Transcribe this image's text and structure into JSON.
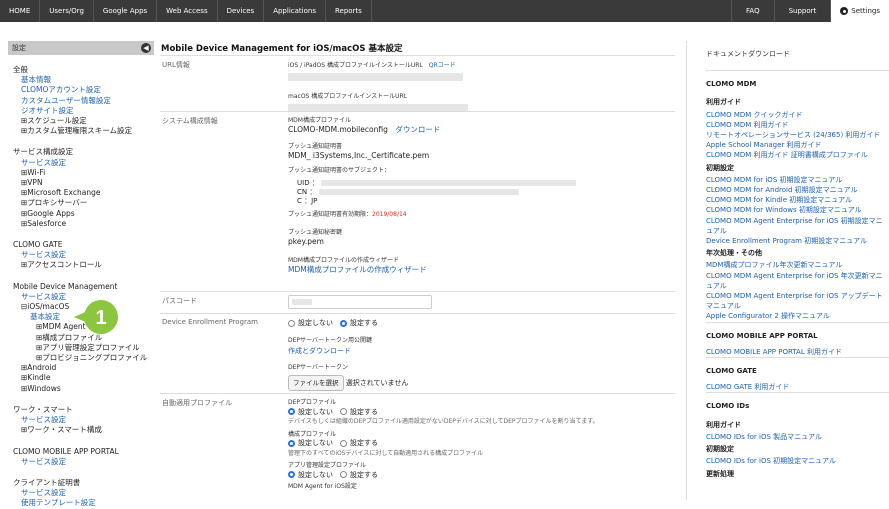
{
  "topnav": {
    "left": [
      "HOME",
      "Users/Org",
      "Google Apps",
      "Web Access",
      "Devices",
      "Applications",
      "Reports"
    ],
    "faq": "FAQ",
    "support": "Support",
    "settings": "Settings"
  },
  "sidebar": {
    "header": "設定",
    "items": [
      {
        "t": "grp",
        "label": "全般"
      },
      {
        "t": "lnk",
        "label": "基本情報"
      },
      {
        "t": "lnk",
        "label": "CLOMOアカウント設定"
      },
      {
        "t": "lnk",
        "label": "カスタムユーザー情報設定"
      },
      {
        "t": "lnk",
        "label": "ジオサイト設定"
      },
      {
        "t": "sub",
        "label": "⊞スケジュール設定"
      },
      {
        "t": "sub",
        "label": "⊞カスタム管理権限スキーム設定"
      },
      {
        "t": "gap"
      },
      {
        "t": "grp",
        "label": "サービス構成設定"
      },
      {
        "t": "lnk",
        "label": "サービス設定"
      },
      {
        "t": "sub",
        "label": "⊞Wi-Fi"
      },
      {
        "t": "sub",
        "label": "⊞VPN"
      },
      {
        "t": "sub",
        "label": "⊞Microsoft Exchange"
      },
      {
        "t": "sub",
        "label": "⊞プロキシサーバー"
      },
      {
        "t": "sub",
        "label": "⊞Google Apps"
      },
      {
        "t": "sub",
        "label": "⊞Salesforce"
      },
      {
        "t": "gap"
      },
      {
        "t": "grp",
        "label": "CLOMO GATE"
      },
      {
        "t": "lnk",
        "label": "サービス設定"
      },
      {
        "t": "sub",
        "label": "⊞アクセスコントロール"
      },
      {
        "t": "gap"
      },
      {
        "t": "grp",
        "label": "Mobile Device Management"
      },
      {
        "t": "lnk",
        "label": "サービス設定"
      },
      {
        "t": "sub",
        "label": "⊟iOS/macOS"
      },
      {
        "t": "sub2a",
        "label": "基本設定"
      },
      {
        "t": "sub3",
        "label": "⊞MDM Agent"
      },
      {
        "t": "sub3",
        "label": "⊞構成プロファイル"
      },
      {
        "t": "sub3",
        "label": "⊞アプリ管理設定プロファイル"
      },
      {
        "t": "sub3",
        "label": "⊞プロビジョニングプロファイル"
      },
      {
        "t": "sub",
        "label": "⊞Android"
      },
      {
        "t": "sub",
        "label": "⊞Kindle"
      },
      {
        "t": "sub",
        "label": "⊞Windows"
      },
      {
        "t": "gap"
      },
      {
        "t": "grp",
        "label": "ワーク・スマート"
      },
      {
        "t": "lnk",
        "label": "サービス設定"
      },
      {
        "t": "sub",
        "label": "⊞ワーク・スマート構成"
      },
      {
        "t": "gap"
      },
      {
        "t": "grp",
        "label": "CLOMO MOBILE APP PORTAL"
      },
      {
        "t": "lnk",
        "label": "サービス設定"
      },
      {
        "t": "gap"
      },
      {
        "t": "grp",
        "label": "クライアント証明書"
      },
      {
        "t": "lnk",
        "label": "サービス設定"
      },
      {
        "t": "lnk",
        "label": "使用テンプレート設定"
      }
    ]
  },
  "callout": "1",
  "main": {
    "title": "Mobile Device Management for iOS/macOS 基本設定",
    "url_label": "URL情報",
    "url_ios": "iOS / iPadOS 構成プロファイルインストールURL",
    "qr": "QRコード",
    "url_mac": "macOS 構成プロファイルインストールURL",
    "sys_label": "システム構成情報",
    "mdm_profile": "MDM構成プロファイル",
    "mdm_file": "CLOMO-MDM.mobileconfig",
    "download": "ダウンロード",
    "push_cert": "プッシュ通知証明書",
    "push_file": "MDM_ i3Systems,Inc._Certificate.pem",
    "push_subject": "プッシュ通知証明書のサブジェクト：",
    "uid": "UID ：",
    "cn": "CN ：",
    "c": "C ：JP",
    "expiry_label": "プッシュ通知証明書有効期限：",
    "expiry": "2019/08/14",
    "push_key": "プッシュ通知秘密鍵",
    "push_key_file": "pkey.pem",
    "wizard_label": "MDM構成プロファイルの作成ウィザード",
    "wizard_link": "MDM構成プロファイルの作成ウィザード",
    "passcode_label": "パスコード",
    "dep_label": "Device Enrollment Program",
    "no_set": "設定しない",
    "do_set": "設定する",
    "dep_key_label": "DEPサーバートークン用公開鍵",
    "dep_key_link": "作成とダウンロード",
    "dep_token_label": "DEPサーバートークン",
    "file_btn": "ファイルを選択",
    "no_file": "選択されていません",
    "auto_label": "自動適用プロファイル",
    "dep_profile": "DEPプロファイル",
    "dep_profile_desc": "デバイスもしくは組織のDEPプロファイル適用設定がないDEPデバイスに対してDEPプロファイルを割り当てます。",
    "config_profile": "構成プロファイル",
    "config_desc": "管理下のすべてのiOSデバイスに対して自動適用される構成プロファイル",
    "app_profile": "アプリ管理設定プロファイル",
    "agent_profile": "MDM Agent for iOS設定"
  },
  "right": {
    "title": "ドキュメントダウンロード",
    "groups": [
      {
        "cat": "CLOMO MDM",
        "secs": [
          {
            "sec": "利用ガイド",
            "links": [
              "CLOMO MDM クイックガイド",
              "CLOMO MDM 利用ガイド",
              "リモートオペレーションサービス (24/365) 利用ガイド",
              "Apple School Manager 利用ガイド",
              "CLOMO MDM 利用ガイド 証明書構成プロファイル"
            ]
          },
          {
            "sec": "初期設定",
            "links": [
              "CLOMO MDM for iOS 初期設定マニュアル",
              "CLOMO MDM for Android 初期設定マニュアル",
              "CLOMO MDM for Kindle 初期設定マニュアル",
              "CLOMO MDM for Windows 初期設定マニュアル",
              "CLOMO MDM Agent Enterprise for iOS 初期設定マニュアル",
              "Device Enrollment Program 初期設定マニュアル"
            ]
          },
          {
            "sec": "年次処理・その他",
            "links": [
              "MDM構成プロファイル年次更新マニュアル",
              "CLOMO MDM Agent Enterprise for iOS 年次更新マニュアル",
              "CLOMO MDM Agent Enterprise for iOS アップデートマニュアル",
              "Apple Configurator 2 操作マニュアル"
            ]
          }
        ]
      },
      {
        "cat": "CLOMO MOBILE APP PORTAL",
        "secs": [
          {
            "sec": "",
            "links": [
              "CLOMO MOBILE APP PORTAL 利用ガイド"
            ]
          }
        ]
      },
      {
        "cat": "CLOMO GATE",
        "secs": [
          {
            "sec": "",
            "links": [
              "CLOMO GATE 利用ガイド"
            ]
          }
        ]
      },
      {
        "cat": "CLOMO IDs",
        "secs": [
          {
            "sec": "利用ガイド",
            "links": [
              "CLOMO IDs for iOS 製品マニュアル"
            ]
          },
          {
            "sec": "初期設定",
            "links": [
              "CLOMO IDs for iOS 初期設定マニュアル"
            ]
          },
          {
            "sec": "更新処理",
            "links": []
          }
        ]
      }
    ]
  }
}
